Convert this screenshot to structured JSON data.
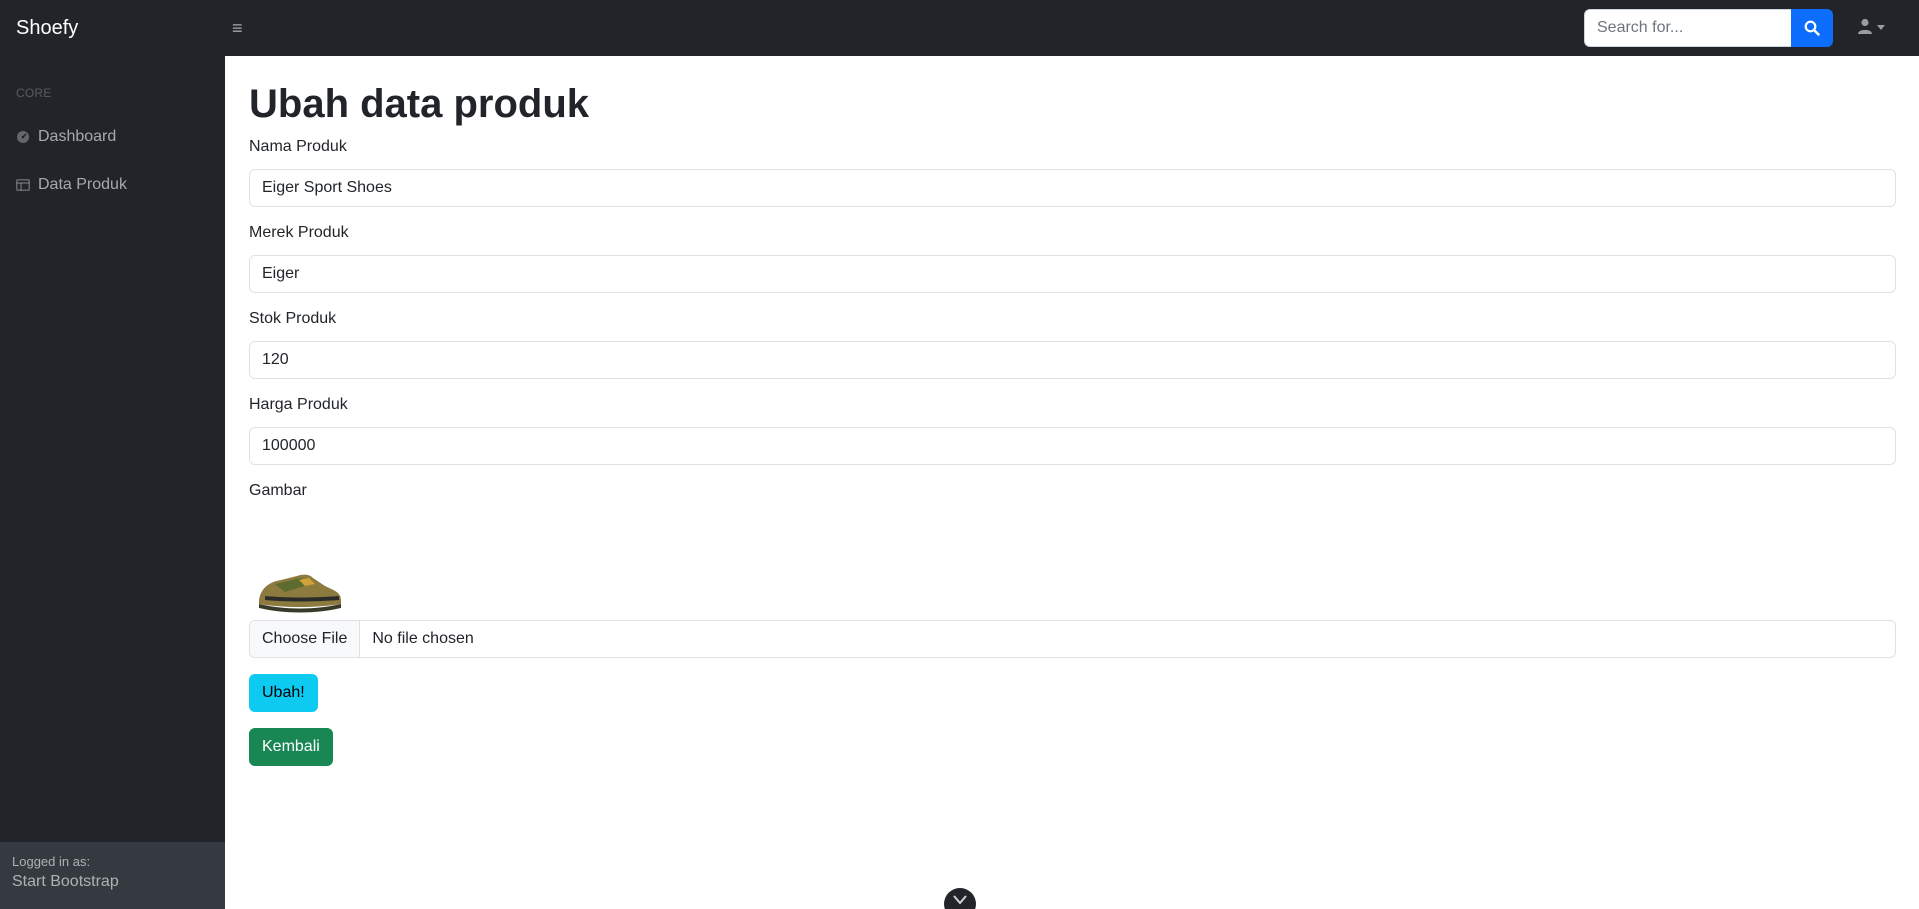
{
  "app": {
    "brand": "Shoefy",
    "colors": {
      "navbar": "#212529",
      "primary": "#0d6efd",
      "info": "#0dcaf0",
      "success": "#198754"
    }
  },
  "topbar": {
    "search_placeholder": "Search for...",
    "search_icon": "search-icon",
    "user_icon": "user-icon"
  },
  "sidebar": {
    "heading": "CORE",
    "items": [
      {
        "label": "Dashboard",
        "icon": "tachometer-icon"
      },
      {
        "label": "Data Produk",
        "icon": "table-icon"
      }
    ],
    "footer": {
      "logged_in_label": "Logged in as:",
      "user_name": "Start Bootstrap"
    }
  },
  "main": {
    "title": "Ubah data produk",
    "fields": {
      "nama": {
        "label": "Nama Produk",
        "value": "Eiger Sport Shoes"
      },
      "merek": {
        "label": "Merek Produk",
        "value": "Eiger"
      },
      "stok": {
        "label": "Stok Produk",
        "value": "120"
      },
      "harga": {
        "label": "Harga Produk",
        "value": "100000"
      }
    },
    "image": {
      "label": "Gambar",
      "choose_button": "Choose File",
      "status": "No file chosen"
    },
    "buttons": {
      "submit": "Ubah!",
      "back": "Kembali"
    }
  }
}
